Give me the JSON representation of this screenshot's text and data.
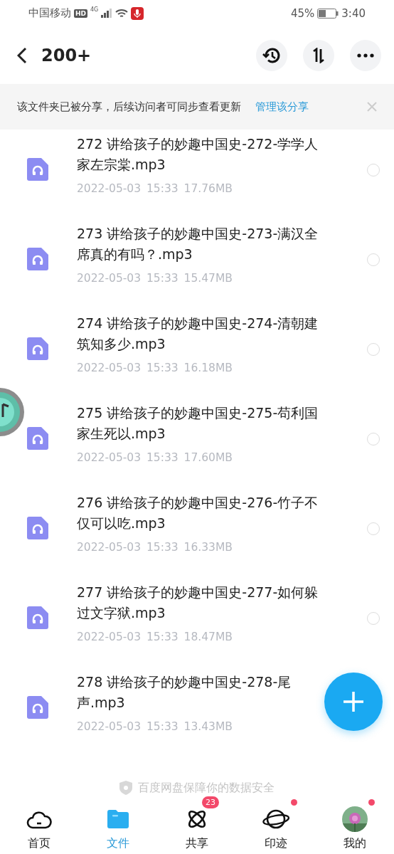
{
  "status_bar": {
    "carrier": "中国移动",
    "hd": "HD",
    "network": "4G",
    "battery": "45%",
    "time": "3:40"
  },
  "header": {
    "title": "200+"
  },
  "banner": {
    "text": "该文件夹已被分享，后续访问者可同步查看更新",
    "link": "管理该分享"
  },
  "files": [
    {
      "title": "272 讲给孩子的妙趣中国史-272-学学人家左宗棠.mp3",
      "date": "2022-05-03",
      "time": "15:33",
      "size": "17.76MB",
      "selected": false
    },
    {
      "title": "273 讲给孩子的妙趣中国史-273-满汉全席真的有吗？.mp3",
      "date": "2022-05-03",
      "time": "15:33",
      "size": "15.47MB",
      "selected": false
    },
    {
      "title": "274 讲给孩子的妙趣中国史-274-清朝建筑知多少.mp3",
      "date": "2022-05-03",
      "time": "15:33",
      "size": "16.18MB",
      "selected": false
    },
    {
      "title": "275 讲给孩子的妙趣中国史-275-苟利国家生死以.mp3",
      "date": "2022-05-03",
      "time": "15:33",
      "size": "17.60MB",
      "selected": false
    },
    {
      "title": "276 讲给孩子的妙趣中国史-276-竹子不仅可以吃.mp3",
      "date": "2022-05-03",
      "time": "15:33",
      "size": "16.33MB",
      "selected": false
    },
    {
      "title": "277 讲给孩子的妙趣中国史-277-如何躲过文字狱.mp3",
      "date": "2022-05-03",
      "time": "15:33",
      "size": "18.47MB",
      "selected": false
    },
    {
      "title": "278 讲给孩子的妙趣中国史-278-尾声.mp3",
      "date": "2022-05-03",
      "time": "15:33",
      "size": "13.43MB"
    }
  ],
  "footer_note": "百度网盘保障你的数据安全",
  "nav": [
    {
      "kind": "home",
      "label": "首页",
      "selected": false
    },
    {
      "kind": "files",
      "label": "文件",
      "selected": true
    },
    {
      "kind": "share",
      "label": "共享",
      "selected": false,
      "badge": "23"
    },
    {
      "kind": "planet",
      "label": "印迹",
      "selected": false,
      "dot": true
    },
    {
      "kind": "avatar",
      "label": "我的",
      "selected": false,
      "dot": true
    }
  ]
}
